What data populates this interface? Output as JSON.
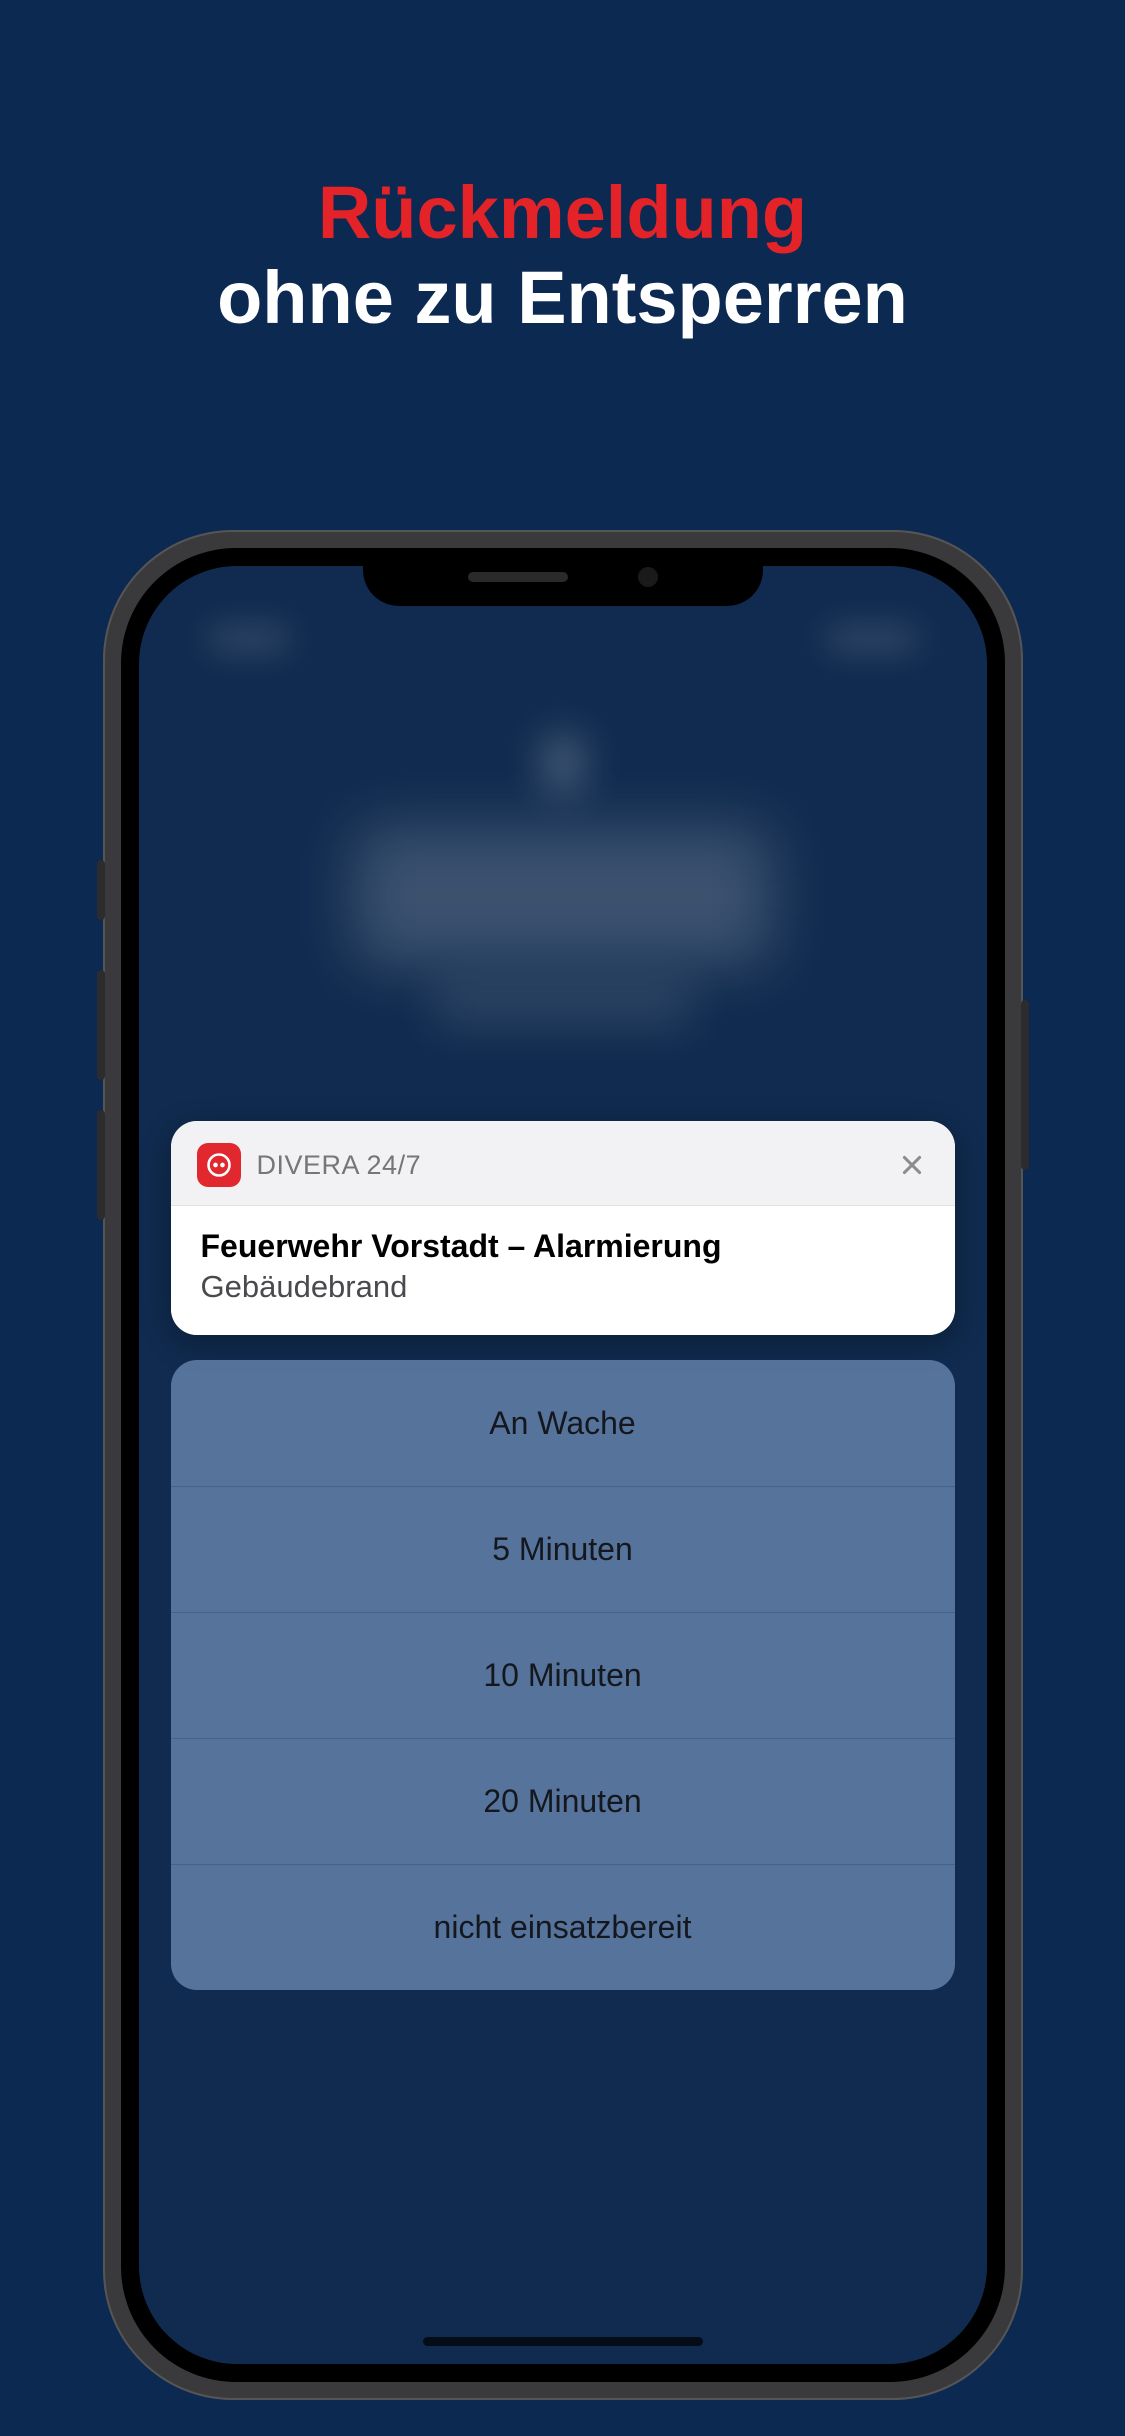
{
  "headline": {
    "line1": "Rückmeldung",
    "line2": "ohne zu Entsperren"
  },
  "notification": {
    "appName": "DIVERA 24/7",
    "title": "Feuerwehr Vorstadt – Alarmierung",
    "subtitle": "Gebäudebrand"
  },
  "responses": [
    "An Wache",
    "5 Minuten",
    "10 Minuten",
    "20 Minuten",
    "nicht einsatzbereit"
  ]
}
